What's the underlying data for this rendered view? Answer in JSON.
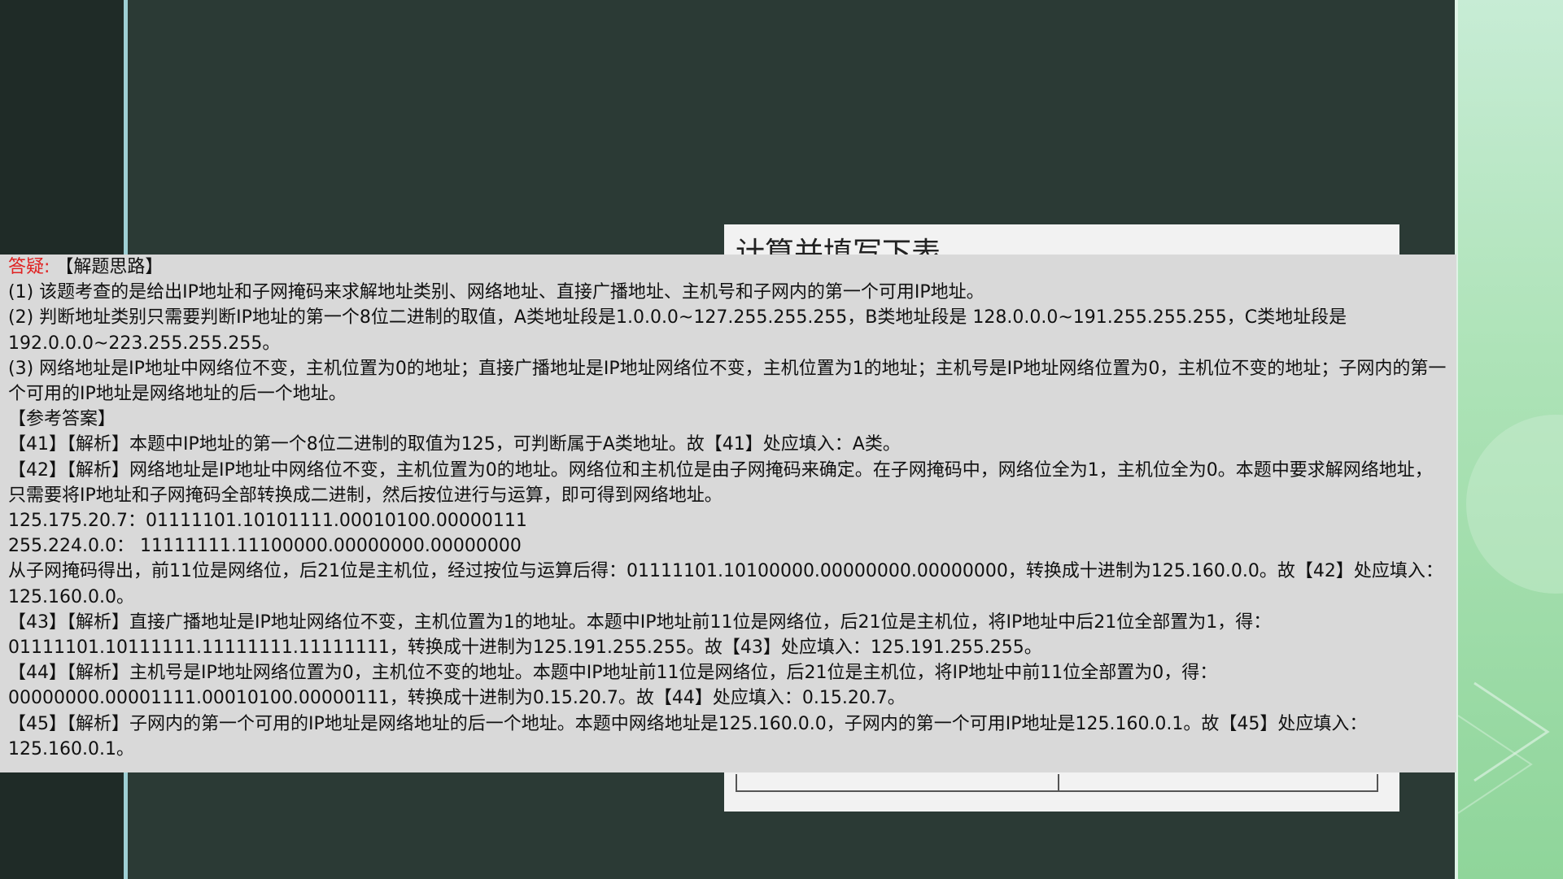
{
  "background_panel": {
    "title": "计算并填写下表"
  },
  "answer": {
    "label": "答疑:",
    "heading_thought": "【解题思路】",
    "lines": [
      " (1) 该题考查的是给出IP地址和子网掩码来求解地址类别、网络地址、直接广播地址、主机号和子网内的第一个可用IP地址。",
      " (2) 判断地址类别只需要判断IP地址的第一个8位二进制的取值，A类地址段是1.0.0.0~127.255.255.255，B类地址段是 128.0.0.0~191.255.255.255，C类地址段是 192.0.0.0~223.255.255.255。",
      " (3) 网络地址是IP地址中网络位不变，主机位置为0的地址；直接广播地址是IP地址网络位不变，主机位置为1的地址；主机号是IP地址网络位置为0，主机位不变的地址；子网内的第一个可用的IP地址是网络地址的后一个地址。",
      "【参考答案】",
      "【41】【解析】本题中IP地址的第一个8位二进制的取值为125，可判断属于A类地址。故【41】处应填入：A类。",
      "【42】【解析】网络地址是IP地址中网络位不变，主机位置为0的地址。网络位和主机位是由子网掩码来确定。在子网掩码中，网络位全为1，主机位全为0。本题中要求解网络地址，只需要将IP地址和子网掩码全部转换成二进制，然后按位进行与运算，即可得到网络地址。",
      "125.175.20.7：01111101.10101111.00010100.00000111",
      "255.224.0.0：  11111111.11100000.00000000.00000000",
      "从子网掩码得出，前11位是网络位，后21位是主机位，经过按位与运算后得：01111101.10100000.00000000.00000000，转换成十进制为125.160.0.0。故【42】处应填入：125.160.0.0。",
      "【43】【解析】直接广播地址是IP地址网络位不变，主机位置为1的地址。本题中IP地址前11位是网络位，后21位是主机位，将IP地址中后21位全部置为1，得：01111101.10111111.11111111.11111111，转换成十进制为125.191.255.255。故【43】处应填入：125.191.255.255。",
      "【44】【解析】主机号是IP地址网络位置为0，主机位不变的地址。本题中IP地址前11位是网络位，后21位是主机位，将IP地址中前11位全部置为0，得：00000000.00001111.00010100.00000111，转换成十进制为0.15.20.7。故【44】处应填入：0.15.20.7。",
      "【45】【解析】子网内的第一个可用的IP地址是网络地址的后一个地址。本题中网络地址是125.160.0.0，子网内的第一个可用IP地址是125.160.0.1。故【45】处应填入：125.160.0.1。"
    ]
  },
  "colors": {
    "label": "#e02020",
    "slide_background": "#2b3a35",
    "answer_background": "#d9d9d9"
  }
}
